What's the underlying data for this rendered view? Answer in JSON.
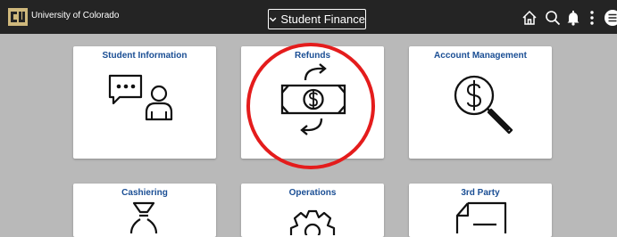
{
  "header": {
    "org_name": "University of Colorado",
    "nav_selector": "Student Finance"
  },
  "icons": {
    "home": "home-icon",
    "search": "search-icon",
    "notifications": "bell-icon",
    "actions": "more-vertical-icon",
    "navbar": "navbar-menu-icon"
  },
  "tiles": [
    {
      "title": "Student Information",
      "icon": "person-chat-icon"
    },
    {
      "title": "Refunds",
      "icon": "money-refund-icon"
    },
    {
      "title": "Account Management",
      "icon": "dollar-magnifier-icon"
    },
    {
      "title": "Cashiering",
      "icon": "money-bag-icon"
    },
    {
      "title": "Operations",
      "icon": "gear-icon"
    },
    {
      "title": "3rd Party",
      "icon": "document-icon"
    }
  ],
  "colors": {
    "topbar": "#242424",
    "tile_title": "#1a4e94",
    "annotation": "#e41c1c",
    "background": "#b9b9b9"
  }
}
